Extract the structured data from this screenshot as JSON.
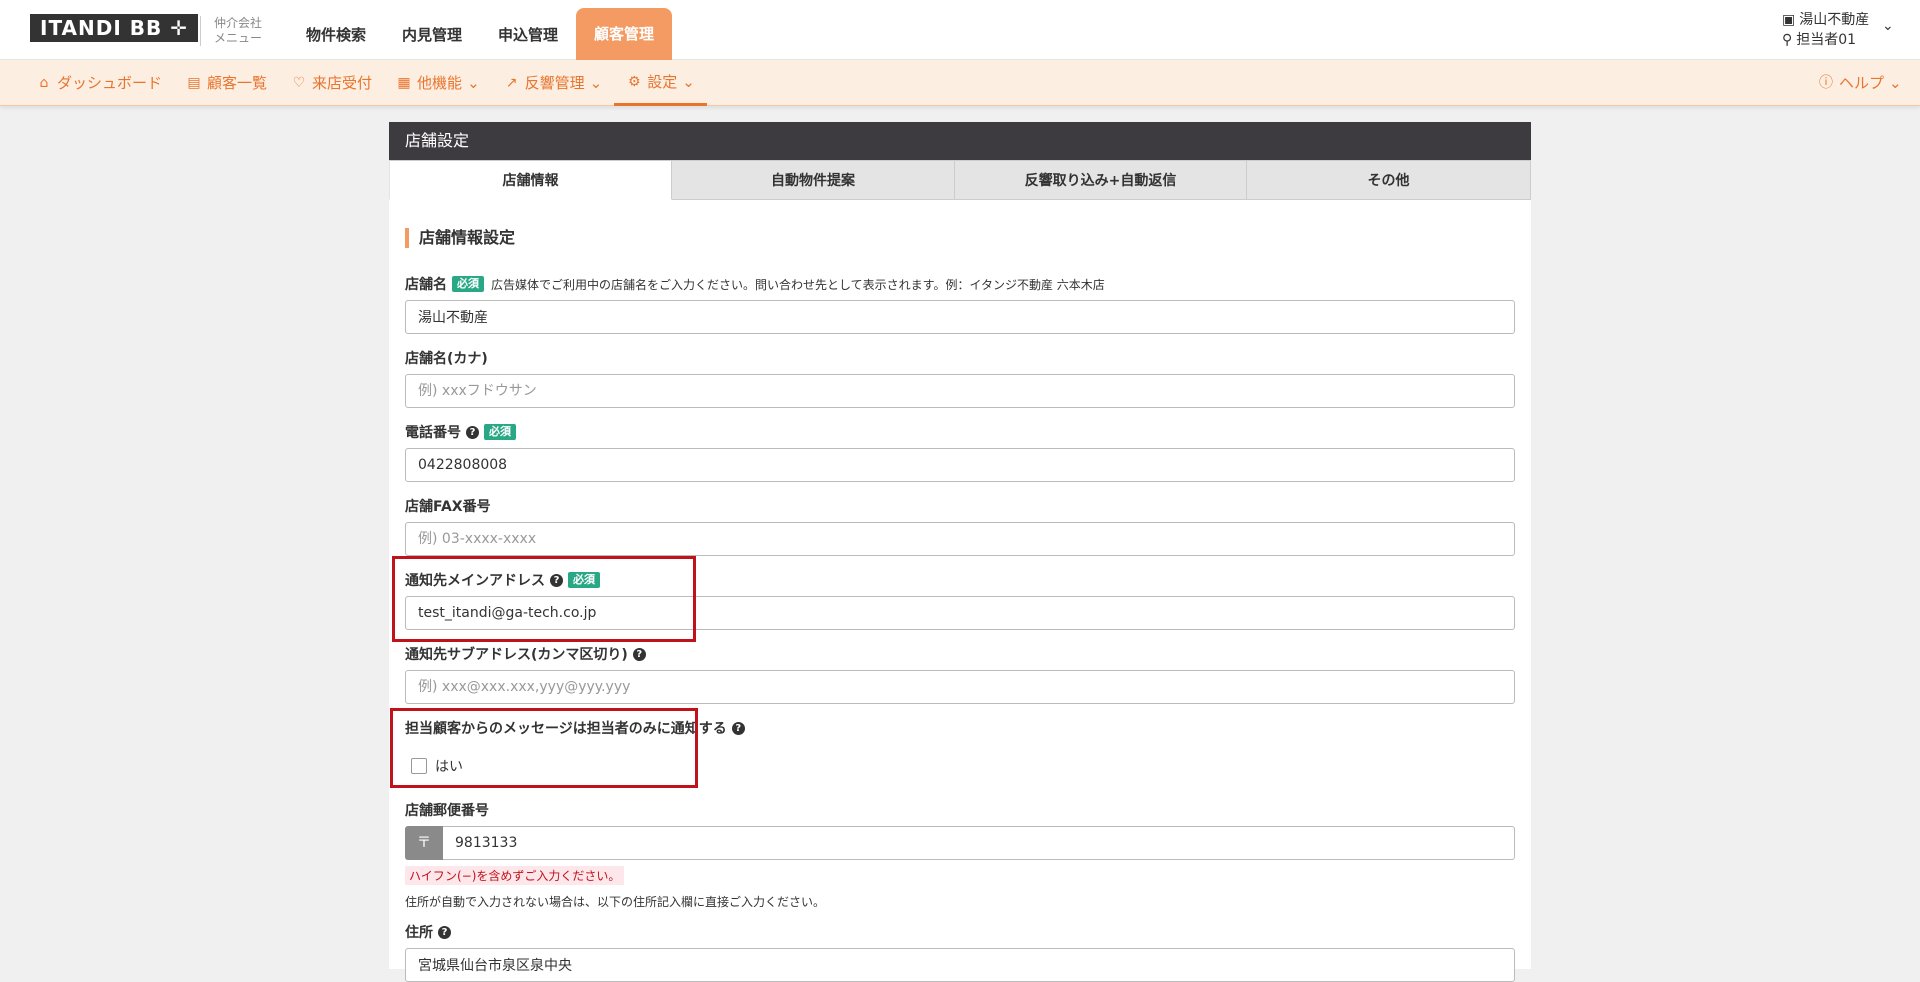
{
  "header": {
    "logo": "ITANDI BB ✛",
    "company_menu_line1": "仲介会社",
    "company_menu_line2": "メニュー",
    "nav": [
      "物件検索",
      "内見管理",
      "申込管理",
      "顧客管理"
    ],
    "active_nav": "顧客管理",
    "user": {
      "company": "湯山不動産",
      "person": "担当者01"
    }
  },
  "subnav": {
    "items": [
      {
        "label": "ダッシュボード",
        "icon": "home-icon"
      },
      {
        "label": "顧客一覧",
        "icon": "customer-list-icon"
      },
      {
        "label": "来店受付",
        "icon": "handshake-icon"
      },
      {
        "label": "他機能",
        "icon": "grid-icon",
        "chevron": true
      },
      {
        "label": "反響管理",
        "icon": "chart-icon",
        "chevron": true
      },
      {
        "label": "設定",
        "icon": "gear-icon",
        "chevron": true
      }
    ],
    "help": "ヘルプ",
    "accent": "#e8752e"
  },
  "panel": {
    "title": "店舗設定",
    "tabs": [
      "店舗情報",
      "自動物件提案",
      "反響取り込み+自動返信",
      "その他"
    ],
    "section_title": "店舗情報設定"
  },
  "form": {
    "store_name": {
      "label": "店舗名",
      "required": "必須",
      "help": "広告媒体でご利用中の店舗名をご入力ください。問い合わせ先として表示されます。例：イタンジ不動産 六本木店",
      "value": "湯山不動産"
    },
    "store_kana": {
      "label": "店舗名(カナ)",
      "placeholder": "例) xxxフドウサン"
    },
    "phone": {
      "label": "電話番号",
      "required": "必須",
      "value": "0422808008"
    },
    "fax": {
      "label": "店舗FAX番号",
      "placeholder": "例) 03-xxxx-xxxx"
    },
    "main_email": {
      "label": "通知先メインアドレス",
      "required": "必須",
      "value": "test_itandi@ga-tech.co.jp"
    },
    "sub_email": {
      "label": "通知先サブアドレス(カンマ区切り)",
      "placeholder": "例) xxx@xxx.xxx,yyy@yyy.yyy"
    },
    "notify_only_assignee": {
      "label": "担当顧客からのメッセージは担当者のみに通知する",
      "option": "はい",
      "checked": false
    },
    "postal": {
      "label": "店舗郵便番号",
      "mark": "〒",
      "value": "9813133",
      "error": "ハイフン(−)を含めずご入力ください。",
      "note": "住所が自動で入力されない場合は、以下の住所記入欄に直接ご入力ください。"
    },
    "address": {
      "label": "住所",
      "value": "宮城県仙台市泉区泉中央"
    }
  },
  "colors": {
    "accent": "#f39b63",
    "required_badge": "#2aa886",
    "highlight": "#c0121b"
  }
}
